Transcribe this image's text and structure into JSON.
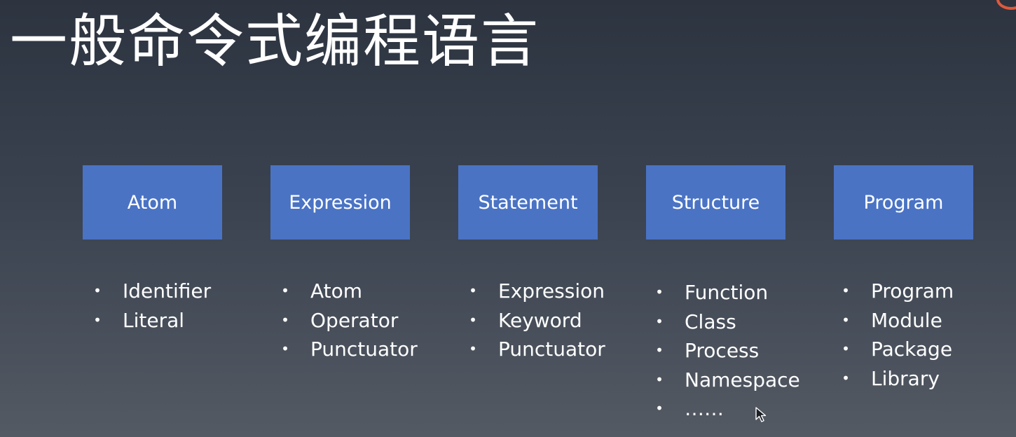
{
  "title": "一般命令式编程语言",
  "columns": [
    {
      "label": "Atom",
      "items": [
        "Identifier",
        "Literal"
      ]
    },
    {
      "label": "Expression",
      "items": [
        "Atom",
        "Operator",
        "Punctuator"
      ]
    },
    {
      "label": "Statement",
      "items": [
        "Expression",
        "Keyword",
        "Punctuator"
      ]
    },
    {
      "label": "Structure",
      "items": [
        "Function",
        "Class",
        "Process",
        "Namespace",
        "……"
      ]
    },
    {
      "label": "Program",
      "items": [
        "Program",
        "Module",
        "Package",
        "Library"
      ]
    }
  ],
  "bullet_glyph": "•",
  "colors": {
    "box_fill": "#4a73c4",
    "text": "#ffffff",
    "badge": "#e0593a"
  },
  "icons": [
    "mouse-cursor-icon"
  ]
}
